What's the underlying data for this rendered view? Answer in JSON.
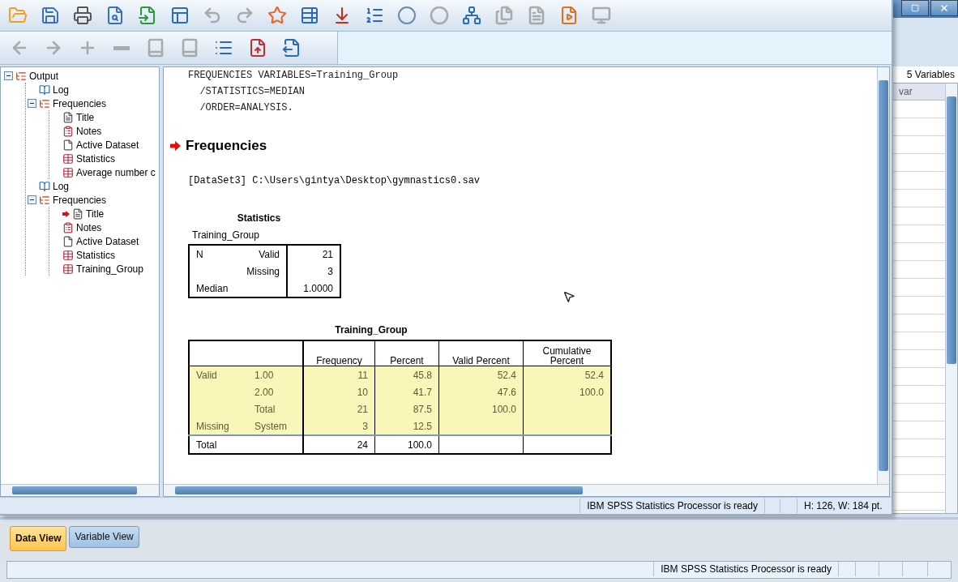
{
  "viewer": {
    "toolbar_main": [
      {
        "kind": "open",
        "disabled": false
      },
      {
        "kind": "save",
        "disabled": false
      },
      {
        "kind": "print",
        "disabled": false
      },
      {
        "kind": "preview",
        "disabled": false
      },
      {
        "kind": "import",
        "disabled": false
      },
      {
        "kind": "dialog",
        "disabled": false
      },
      {
        "kind": "undo",
        "disabled": true
      },
      {
        "kind": "redo",
        "disabled": true
      },
      {
        "kind": "star",
        "disabled": false
      },
      {
        "kind": "table-back",
        "disabled": false
      },
      {
        "kind": "table-down",
        "disabled": false
      },
      {
        "kind": "variables",
        "disabled": false
      },
      {
        "kind": "circles",
        "disabled": false
      },
      {
        "kind": "circles",
        "disabled": true
      },
      {
        "kind": "hierarchy",
        "disabled": false
      },
      {
        "kind": "files",
        "disabled": true
      },
      {
        "kind": "document",
        "disabled": true
      },
      {
        "kind": "play",
        "disabled": false
      },
      {
        "kind": "monitor",
        "disabled": true
      }
    ],
    "toolbar_outline": [
      {
        "kind": "back",
        "disabled": true
      },
      {
        "kind": "forward",
        "disabled": true
      },
      {
        "kind": "plus",
        "disabled": true
      },
      {
        "kind": "minus",
        "disabled": true
      },
      {
        "kind": "book",
        "disabled": true
      },
      {
        "kind": "book",
        "disabled": true
      },
      {
        "kind": "list",
        "disabled": false
      },
      {
        "kind": "upload",
        "disabled": false
      },
      {
        "kind": "export",
        "disabled": false
      }
    ],
    "outline": [
      {
        "label": "Output",
        "kind": "group",
        "expanded": true,
        "current": false,
        "children": [
          {
            "label": "Log",
            "kind": "log",
            "current": false
          },
          {
            "label": "Frequencies",
            "kind": "group",
            "expanded": true,
            "current": false,
            "children": [
              {
                "label": "Title",
                "kind": "title",
                "current": false
              },
              {
                "label": "Notes",
                "kind": "notes",
                "current": false
              },
              {
                "label": "Active Dataset",
                "kind": "dataset",
                "current": false
              },
              {
                "label": "Statistics",
                "kind": "table",
                "current": false
              },
              {
                "label": "Average number c",
                "kind": "table",
                "current": false
              }
            ]
          },
          {
            "label": "Log",
            "kind": "log",
            "current": false
          },
          {
            "label": "Frequencies",
            "kind": "group",
            "expanded": true,
            "current": false,
            "children": [
              {
                "label": "Title",
                "kind": "title",
                "current": true
              },
              {
                "label": "Notes",
                "kind": "notes",
                "current": false
              },
              {
                "label": "Active Dataset",
                "kind": "dataset",
                "current": false
              },
              {
                "label": "Statistics",
                "kind": "table",
                "current": false
              },
              {
                "label": "Training_Group",
                "kind": "table",
                "current": false
              }
            ]
          }
        ]
      }
    ],
    "syntax": [
      "FREQUENCIES VARIABLES=Training_Group",
      "  /STATISTICS=MEDIAN",
      "  /ORDER=ANALYSIS."
    ],
    "heading": "Frequencies",
    "dataset_line": "[DataSet3] C:\\Users\\gintya\\Desktop\\gymnastics0.sav",
    "statistics_table": {
      "title": "Statistics",
      "subtitle": "Training_Group",
      "rows": [
        [
          "N",
          "Valid",
          "21"
        ],
        [
          "",
          "Missing",
          "3"
        ],
        [
          "Median",
          "",
          "1.0000"
        ]
      ]
    },
    "frequency_table": {
      "title": "Training_Group",
      "columns": [
        "",
        "",
        "Frequency",
        "Percent",
        "Valid Percent",
        "Cumulative Percent"
      ],
      "rows": [
        {
          "cells": [
            "Valid",
            "1.00",
            "11",
            "45.8",
            "52.4",
            "52.4"
          ],
          "selected": true
        },
        {
          "cells": [
            "",
            "2.00",
            "10",
            "41.7",
            "47.6",
            "100.0"
          ],
          "selected": true
        },
        {
          "cells": [
            "",
            "Total",
            "21",
            "87.5",
            "100.0",
            ""
          ],
          "selected": true
        },
        {
          "cells": [
            "Missing",
            "System",
            "3",
            "12.5",
            "",
            ""
          ],
          "selected": true
        },
        {
          "cells": [
            "Total",
            "",
            "24",
            "100.0",
            "",
            ""
          ],
          "selected": false
        }
      ]
    },
    "status": [
      "IBM SPSS Statistics Processor is ready",
      "H: 126, W: 184 pt."
    ]
  },
  "data_editor": {
    "variable_count": "5 Variables",
    "column": "var",
    "tabs": [
      {
        "label": "Data View",
        "selected": true
      },
      {
        "label": "Variable View",
        "selected": false
      }
    ],
    "status": "IBM SPSS Statistics Processor is ready"
  }
}
